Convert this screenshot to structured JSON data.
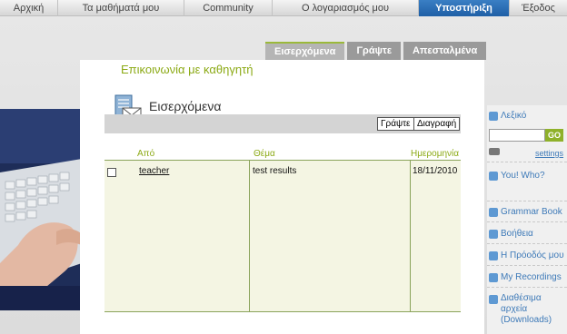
{
  "nav": {
    "items": [
      {
        "label": "Αρχική"
      },
      {
        "label": "Τα μαθήματά μου"
      },
      {
        "label": "Community"
      },
      {
        "label": "Ο λογαριασμός μου"
      },
      {
        "label": "Υποστήριξη"
      },
      {
        "label": "Έξοδος"
      }
    ],
    "active_index": 4
  },
  "tabs": [
    {
      "label": "Εισερχόμενα"
    },
    {
      "label": "Γράψτε"
    },
    {
      "label": "Απεσταλμένα"
    }
  ],
  "page": {
    "heading": "Επικοινωνία με καθηγητή",
    "folder_title": "Εισερχόμενα",
    "write_button": "Γράψτε",
    "delete_button": "Διαγραφή"
  },
  "table": {
    "columns": [
      "Από",
      "Θέμα",
      "Ημερομηνία"
    ],
    "rows": [
      {
        "from": "teacher",
        "subject": "test results",
        "date": "18/11/2010"
      }
    ]
  },
  "sidebar": {
    "dictionary_label": "Λεξικό",
    "search_placeholder": "",
    "go_label": "GO",
    "settings_link": "settings",
    "youwho_label": "You! Who?",
    "links": [
      {
        "label": "Grammar Book"
      },
      {
        "label": "Βοήθεια"
      },
      {
        "label": "Η Πρόοδός μου"
      },
      {
        "label": "My Recordings"
      },
      {
        "label": "Διαθέσιμα αρχεία (Downloads)"
      }
    ]
  },
  "colors": {
    "accent_green": "#8caa16",
    "nav_active": "#2a6db5",
    "link_blue": "#3e7ab8"
  }
}
